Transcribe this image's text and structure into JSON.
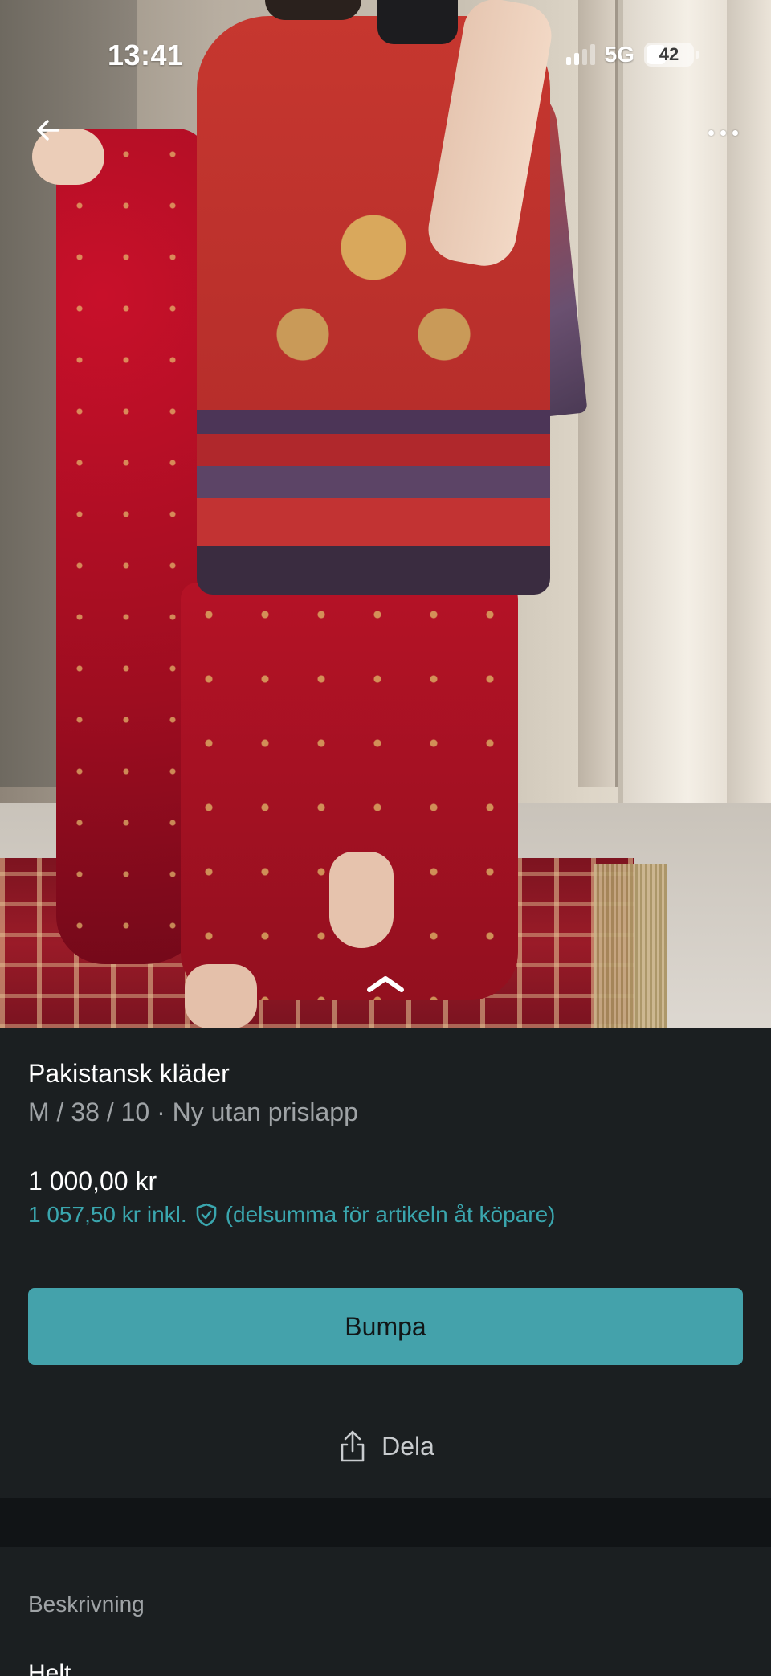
{
  "status_bar": {
    "time": "13:41",
    "network": "5G",
    "battery": "42"
  },
  "listing": {
    "title": "Pakistansk kläder",
    "subtitle": "M / 38 / 10 · Ny utan prislapp",
    "price": "1 000,00 kr",
    "price_incl_amount": "1 057,50 kr inkl.",
    "price_incl_note": "(delsumma för artikeln åt köpare)"
  },
  "actions": {
    "bumpa_label": "Bumpa",
    "dela_label": "Dela"
  },
  "description": {
    "label": "Beskrivning",
    "text_partial": "Helt"
  },
  "colors": {
    "accent": "#44a2ab",
    "link": "#3aa6ae",
    "background": "#1b1f21"
  },
  "icons": {
    "back": "arrow-left-icon",
    "more": "more-dots-icon",
    "expand": "chevron-up-icon",
    "buyer_protection": "shield-check-icon",
    "share": "share-icon"
  }
}
